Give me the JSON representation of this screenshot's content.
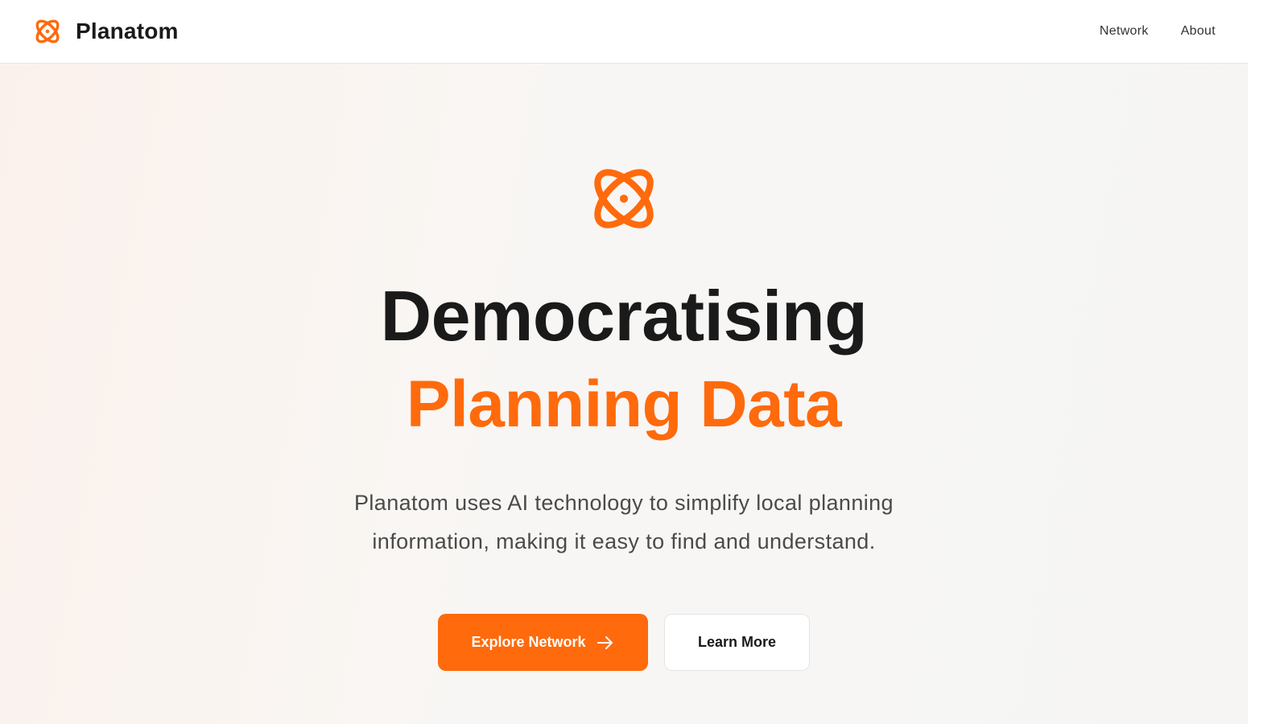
{
  "header": {
    "brand_name": "Planatom",
    "brand_icon": "atom-icon",
    "nav": [
      {
        "label": "Network"
      },
      {
        "label": "About"
      }
    ]
  },
  "hero": {
    "icon": "atom-icon",
    "title_line_1": "Democratising",
    "title_line_2": "Planning Data",
    "description": "Planatom uses AI technology to simplify local planning information, making it easy to find and understand.",
    "primary_cta": {
      "label": "Explore Network",
      "icon": "arrow-right-icon"
    },
    "secondary_cta": {
      "label": "Learn More"
    }
  },
  "colors": {
    "accent": "#ff6a0c",
    "text_dark": "#1a1a1a",
    "text_muted": "#4a4a4a"
  }
}
